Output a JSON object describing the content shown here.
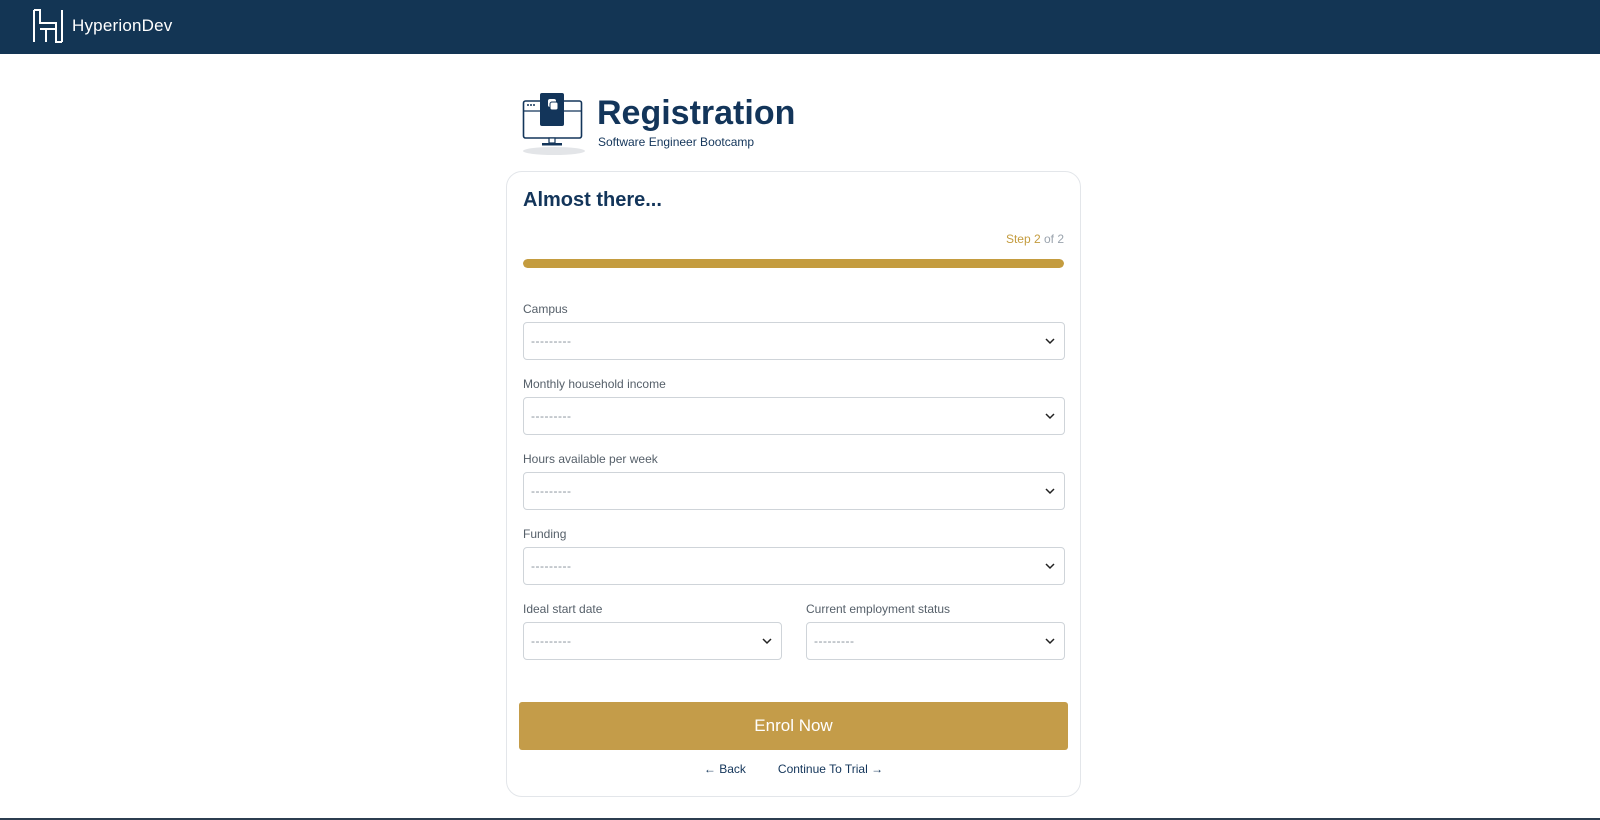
{
  "brand": {
    "name": "HyperionDev",
    "logo_icon": "hyperiondev-logo-icon"
  },
  "hero": {
    "title": "Registration",
    "subtitle": "Software Engineer Bootcamp",
    "icon": "computer-python-icon"
  },
  "form": {
    "heading": "Almost there...",
    "step": {
      "current_label": "Step 2",
      "total_label": "of 2",
      "progress_fraction": 1.0
    },
    "fields": [
      {
        "label": "Campus",
        "value": "---------"
      },
      {
        "label": "Monthly household income",
        "value": "---------"
      },
      {
        "label": "Hours available per week",
        "value": "---------"
      },
      {
        "label": "Funding",
        "value": "---------"
      },
      {
        "label": "Ideal start date",
        "value": "---------"
      },
      {
        "label": "Current employment status",
        "value": "---------"
      }
    ],
    "submit_label": "Enrol Now",
    "back_label": "← Back",
    "trial_label": "Continue To Trial →"
  },
  "colors": {
    "navbar": "#133554",
    "accent": "#c49c3f",
    "text": "#13355a"
  }
}
